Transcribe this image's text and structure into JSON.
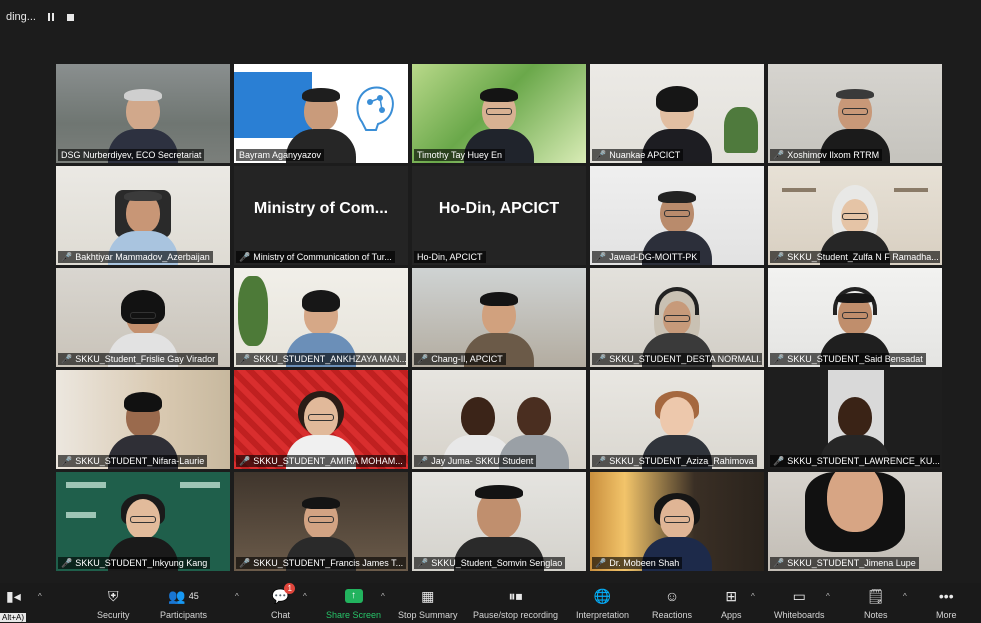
{
  "recording": {
    "label": "ding..."
  },
  "participants": [
    {
      "name": "DSG Nurberdiyev, ECO Secretariat",
      "muted": false
    },
    {
      "name": "Bayram Aganyyazov",
      "muted": false,
      "active_speaker": true
    },
    {
      "name": "Timothy Tay Huey En",
      "muted": false
    },
    {
      "name": "Nuankae APCICT",
      "muted": true
    },
    {
      "name": "Xoshimov Ilxom RTRM",
      "muted": true
    },
    {
      "name": "Bakhtiyar Mammadov_Azerbaijan",
      "muted": true
    },
    {
      "name": "Ministry of Communication of Tur...",
      "muted": true,
      "display_name": "Ministry of Com..."
    },
    {
      "name": "Ho-Din, APCICT",
      "muted": false,
      "display_name": "Ho-Din, APCICT"
    },
    {
      "name": "Jawad-DG-MOITT-PK",
      "muted": true
    },
    {
      "name": "SKKU_Student_Zulfa N F Ramadha...",
      "muted": true
    },
    {
      "name": "SKKU_Student_Frislie Gay Virador",
      "muted": true
    },
    {
      "name": "SKKU_STUDENT_ANKHZAYA MAN...",
      "muted": true
    },
    {
      "name": "Chang-Il, APCICT",
      "muted": true
    },
    {
      "name": "SKKU_STUDENT_DESTA NORMALI...",
      "muted": true
    },
    {
      "name": "SKKU_STUDENT_Said Bensadat",
      "muted": true
    },
    {
      "name": "SKKU_STUDENT_Nifara-Laurie",
      "muted": true
    },
    {
      "name": "SKKU_STUDENT_AMIRA MOHAM...",
      "muted": true
    },
    {
      "name": "Jay Juma- SKKU Student",
      "muted": true
    },
    {
      "name": "SKKU_STUDENT_Aziza_Rahimova",
      "muted": true
    },
    {
      "name": "SKKU_STUDENT_LAWRENCE_KU...",
      "muted": true
    },
    {
      "name": "SKKU_STUDENT_Inkyung Kang",
      "muted": true
    },
    {
      "name": "SKKU_STUDENT_Francis James T...",
      "muted": true
    },
    {
      "name": "SKKU_Student_Somvin Senglao",
      "muted": true
    },
    {
      "name": "Dr. Mobeen Shah",
      "muted": true
    },
    {
      "name": "SKKU_STUDENT_Jimena Lupe",
      "muted": true
    }
  ],
  "toolbar": {
    "alt_hint": "Alt+A)",
    "participants_count": "45",
    "chat_badge": "1",
    "items": [
      "Security",
      "Participants",
      "Chat",
      "Share Screen",
      "Stop Summary",
      "Pause/stop recording",
      "Interpretation",
      "Reactions",
      "Apps",
      "Whiteboards",
      "Notes",
      "More"
    ]
  },
  "colors": {
    "active_border": "#e3ee57",
    "share_green": "#22b35e",
    "mute_red": "#e0453b",
    "background": "#1c1c1c"
  }
}
